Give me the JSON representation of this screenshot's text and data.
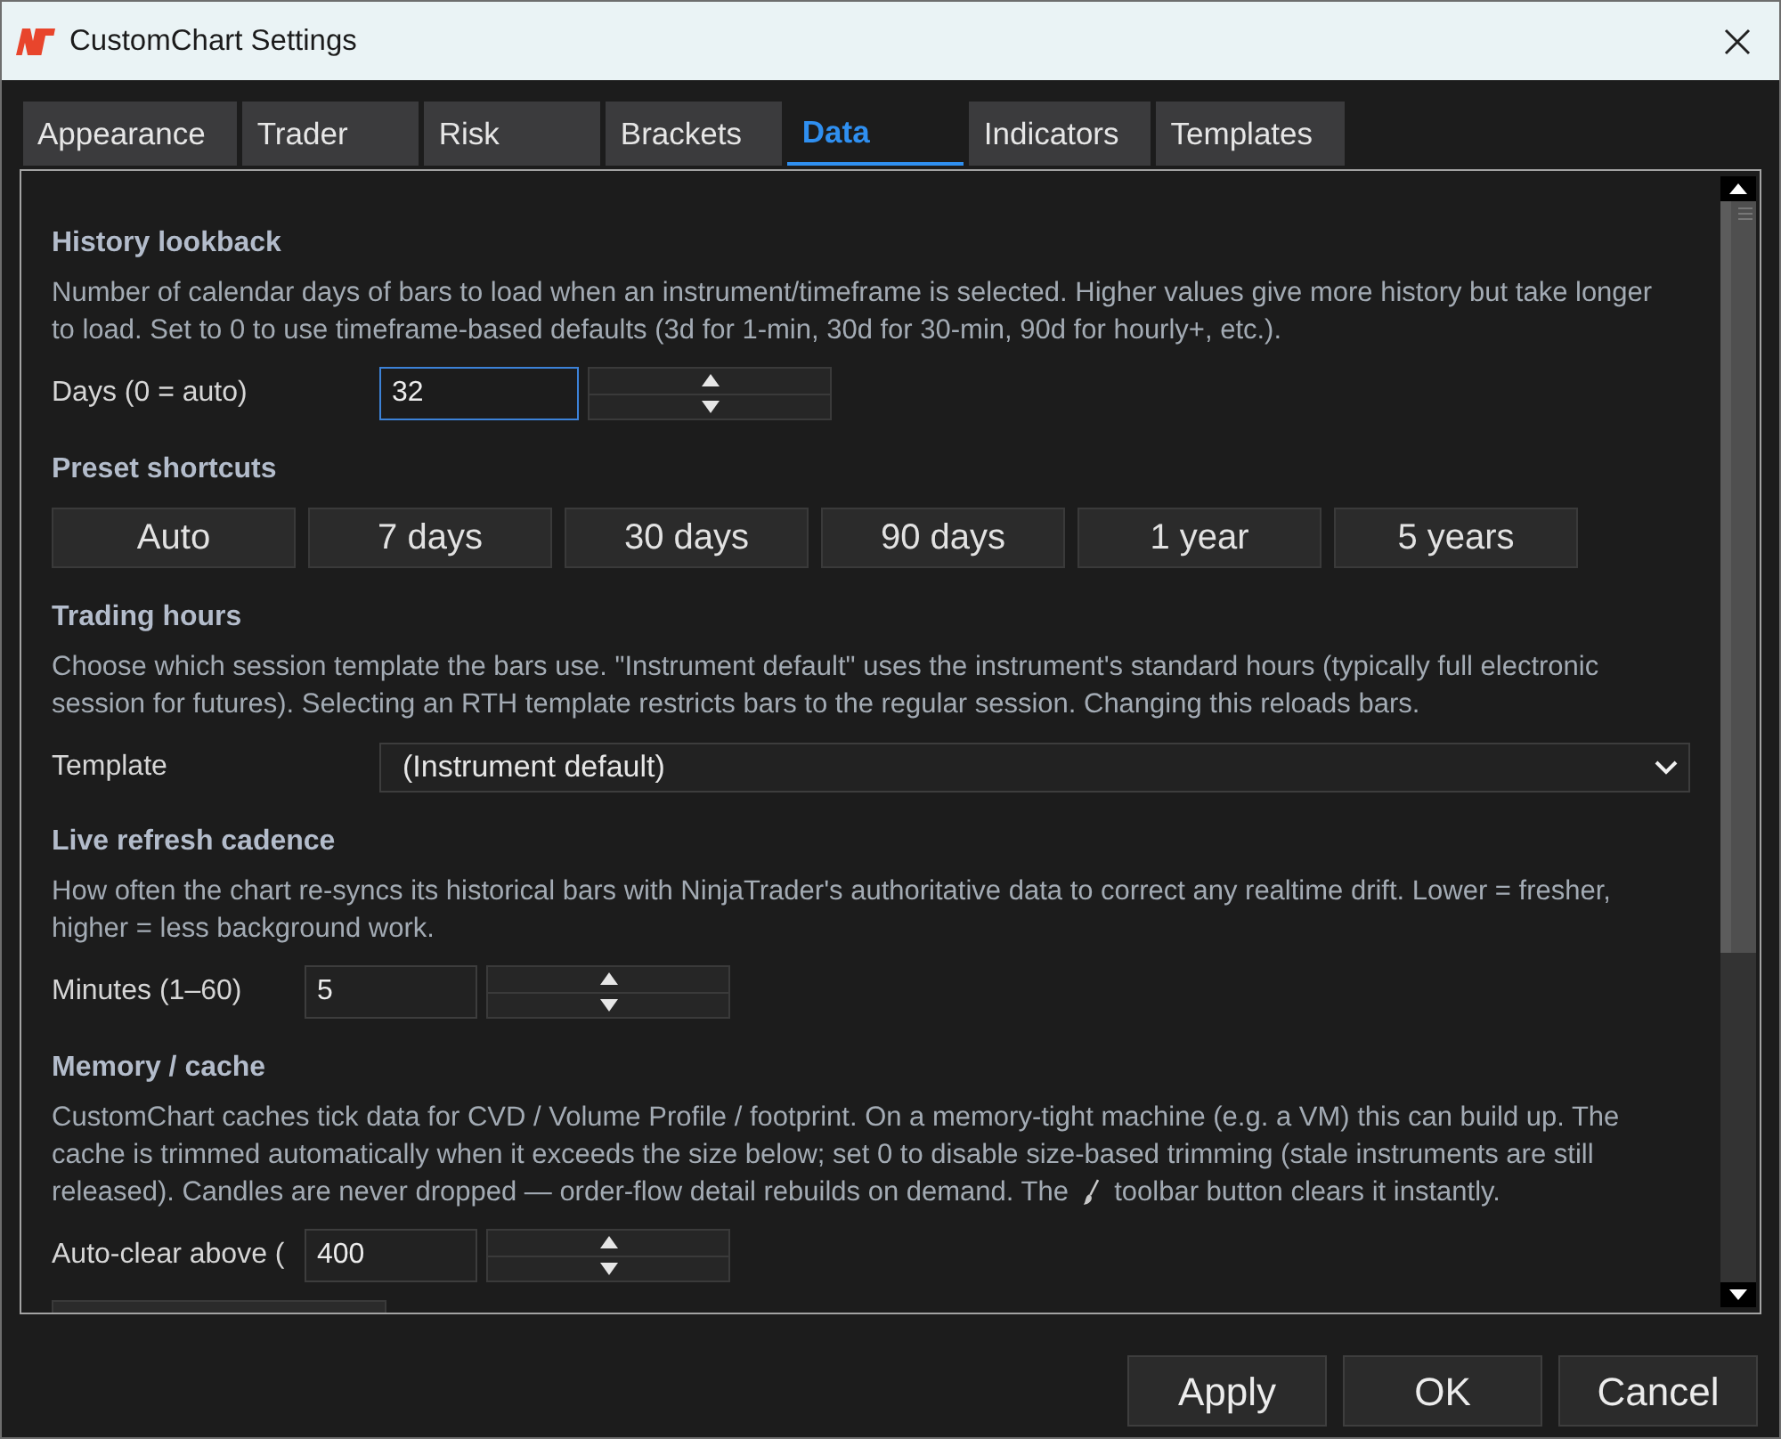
{
  "window": {
    "title": "CustomChart Settings"
  },
  "tabs": [
    {
      "label": "Appearance",
      "selected": false
    },
    {
      "label": "Trader",
      "selected": false
    },
    {
      "label": "Risk",
      "selected": false
    },
    {
      "label": "Brackets",
      "selected": false
    },
    {
      "label": "Data",
      "selected": true
    },
    {
      "label": "Indicators",
      "selected": false
    },
    {
      "label": "Templates",
      "selected": false
    }
  ],
  "sections": [
    {
      "heading": "History lookback",
      "description": "Number of calendar days of bars to load when an instrument/timeframe is selected. Higher values give more history but take longer to load. Set to 0 to use timeframe-based defaults (3d for 1-min, 30d for 30-min, 90d for hourly+, etc.).",
      "control": {
        "kind": "spinner",
        "label": "Days (0 = auto)",
        "value": "32",
        "focused": true
      }
    },
    {
      "heading": "Preset shortcuts",
      "control": {
        "kind": "buttons",
        "buttons": [
          "Auto",
          "7 days",
          "30 days",
          "90 days",
          "1 year",
          "5 years"
        ]
      }
    },
    {
      "heading": "Trading hours",
      "description": "Choose which session template the bars use. \"Instrument default\" uses the instrument's standard hours (typically full electronic session for futures). Selecting an RTH template restricts bars to the regular session. Changing this reloads bars.",
      "control": {
        "kind": "select",
        "label": "Template",
        "value": "(Instrument default)"
      }
    },
    {
      "heading": "Live refresh cadence",
      "description": "How often the chart re-syncs its historical bars with NinjaTrader's authoritative data to correct any realtime drift. Lower = fresher, higher = less background work.",
      "control": {
        "kind": "spinner",
        "label": "Minutes (1–60)",
        "value": "5",
        "focused": false
      }
    },
    {
      "heading": "Memory / cache",
      "description": "CustomChart caches tick data for CVD / Volume Profile / footprint. On a memory-tight machine (e.g. a VM) this can build up. The cache is trimmed automatically when it exceeds the size below; set 0 to disable size-based trimming (stale instruments are still released). Candles are never dropped — order-flow detail rebuilds on demand. The",
      "description_after_icon": "toolbar button clears it instantly.",
      "control": {
        "kind": "spinner",
        "label": "Auto-clear above (",
        "value": "400",
        "focused": false
      }
    }
  ],
  "buttons": [
    "Apply",
    "OK",
    "Cancel"
  ]
}
